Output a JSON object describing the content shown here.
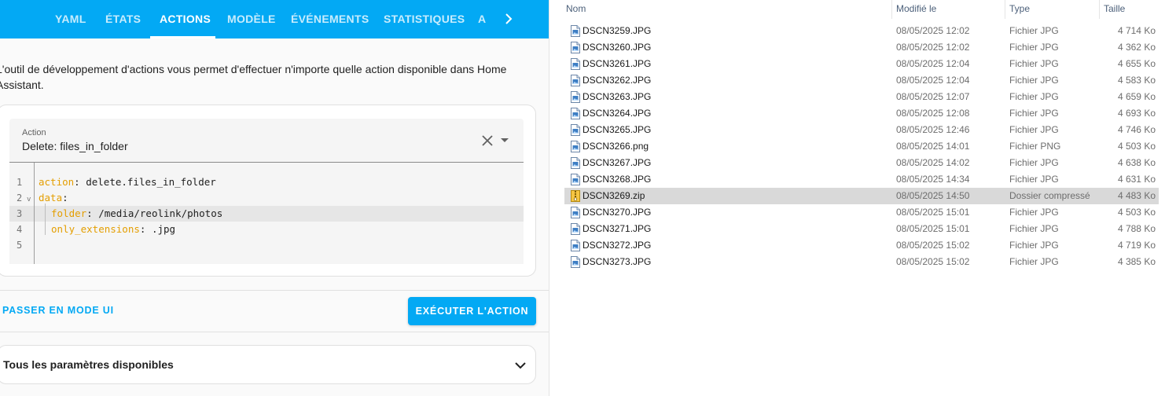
{
  "ha": {
    "tabs": [
      {
        "label": "YAML",
        "active": false
      },
      {
        "label": "ÉTATS",
        "active": false
      },
      {
        "label": "ACTIONS",
        "active": true
      },
      {
        "label": "MODÈLE",
        "active": false
      },
      {
        "label": "ÉVÉNEMENTS",
        "active": false
      },
      {
        "label": "STATISTIQUES",
        "active": false
      },
      {
        "label": "A",
        "active": false
      }
    ],
    "intro_text": "L'outil de développement d'actions vous permet d'effectuer n'importe quelle action disponible dans Home Assistant.",
    "action_label": "Action",
    "action_value": "Delete: files_in_folder",
    "code_lines": [
      {
        "num": "1",
        "key": "action",
        "value": " delete.files_in_folder"
      },
      {
        "num": "2",
        "key": "data",
        "value": ""
      },
      {
        "num": "3",
        "key": "folder",
        "value": " /media/reolink/photos"
      },
      {
        "num": "4",
        "key": "only_extensions",
        "value": " .jpg"
      },
      {
        "num": "5",
        "key": "",
        "value": ""
      }
    ],
    "ui_mode_label": "PASSER EN MODE UI",
    "run_label": "EXÉCUTER L'ACTION",
    "params_label": "Tous les paramètres disponibles",
    "accent_color": "#03a9f4"
  },
  "explorer": {
    "headers": {
      "name": "Nom",
      "modified": "Modifié le",
      "type": "Type",
      "size": "Taille"
    },
    "files": [
      {
        "name": "DSCN3259.JPG",
        "modified": "08/05/2025 12:02",
        "type": "Fichier JPG",
        "size": "4 714 Ko",
        "icon": "image-file-icon"
      },
      {
        "name": "DSCN3260.JPG",
        "modified": "08/05/2025 12:02",
        "type": "Fichier JPG",
        "size": "4 362 Ko",
        "icon": "image-file-icon"
      },
      {
        "name": "DSCN3261.JPG",
        "modified": "08/05/2025 12:04",
        "type": "Fichier JPG",
        "size": "4 655 Ko",
        "icon": "image-file-icon"
      },
      {
        "name": "DSCN3262.JPG",
        "modified": "08/05/2025 12:04",
        "type": "Fichier JPG",
        "size": "4 583 Ko",
        "icon": "image-file-icon"
      },
      {
        "name": "DSCN3263.JPG",
        "modified": "08/05/2025 12:07",
        "type": "Fichier JPG",
        "size": "4 659 Ko",
        "icon": "image-file-icon"
      },
      {
        "name": "DSCN3264.JPG",
        "modified": "08/05/2025 12:08",
        "type": "Fichier JPG",
        "size": "4 693 Ko",
        "icon": "image-file-icon"
      },
      {
        "name": "DSCN3265.JPG",
        "modified": "08/05/2025 12:46",
        "type": "Fichier JPG",
        "size": "4 746 Ko",
        "icon": "image-file-icon"
      },
      {
        "name": "DSCN3266.png",
        "modified": "08/05/2025 14:01",
        "type": "Fichier PNG",
        "size": "4 503 Ko",
        "icon": "image-file-icon"
      },
      {
        "name": "DSCN3267.JPG",
        "modified": "08/05/2025 14:02",
        "type": "Fichier JPG",
        "size": "4 638 Ko",
        "icon": "image-file-icon"
      },
      {
        "name": "DSCN3268.JPG",
        "modified": "08/05/2025 14:34",
        "type": "Fichier JPG",
        "size": "4 631 Ko",
        "icon": "image-file-icon"
      },
      {
        "name": "DSCN3269.zip",
        "modified": "08/05/2025 14:50",
        "type": "Dossier compressé",
        "size": "4 483 Ko",
        "icon": "zip-folder-icon",
        "selected": true
      },
      {
        "name": "DSCN3270.JPG",
        "modified": "08/05/2025 15:01",
        "type": "Fichier JPG",
        "size": "4 503 Ko",
        "icon": "image-file-icon"
      },
      {
        "name": "DSCN3271.JPG",
        "modified": "08/05/2025 15:01",
        "type": "Fichier JPG",
        "size": "4 788 Ko",
        "icon": "image-file-icon"
      },
      {
        "name": "DSCN3272.JPG",
        "modified": "08/05/2025 15:02",
        "type": "Fichier JPG",
        "size": "4 719 Ko",
        "icon": "image-file-icon"
      },
      {
        "name": "DSCN3273.JPG",
        "modified": "08/05/2025 15:02",
        "type": "Fichier JPG",
        "size": "4 385 Ko",
        "icon": "image-file-icon"
      }
    ]
  }
}
